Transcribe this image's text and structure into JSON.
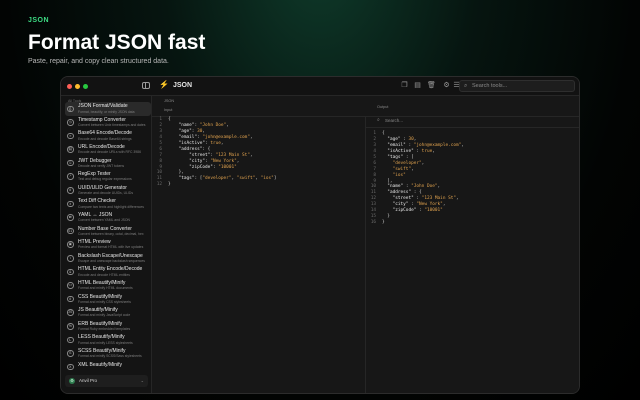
{
  "hero": {
    "tag": "JSON",
    "title": "Format JSON fast",
    "subtitle": "Paste, repair, and copy clean structured data."
  },
  "window": {
    "title": "JSON",
    "search_placeholder": "Search tools..."
  },
  "sidebar": {
    "heading": "All Tools",
    "items": [
      {
        "title": "JSON Format/Validate",
        "desc": "Format, beautify, or minify JSON data",
        "icon": "{}",
        "active": true
      },
      {
        "title": "Timestamp Converter",
        "desc": "Convert between Unix timestamps and dates",
        "icon": "◷",
        "active": false
      },
      {
        "title": "Base64 Encode/Decode",
        "desc": "Encode and decode Base64 strings",
        "icon": "≡",
        "active": false
      },
      {
        "title": "URL Encode/Decode",
        "desc": "Encode and decode URLs with RFC 3986",
        "icon": "⛓",
        "active": false
      },
      {
        "title": "JWT Debugger",
        "desc": "Decode and verify JWT tokens",
        "icon": "⚿",
        "active": false
      },
      {
        "title": "RegExp Tester",
        "desc": "Test and debug regular expressions",
        "icon": ".*",
        "active": false
      },
      {
        "title": "UUID/ULID Generator",
        "desc": "Generate and decode UUIDs, ULIDs",
        "icon": "#",
        "active": false
      },
      {
        "title": "Text Diff Checker",
        "desc": "Compare two texts and highlight differences",
        "icon": "±",
        "active": false
      },
      {
        "title": "YAML ↔ JSON",
        "desc": "Convert between YAML and JSON",
        "icon": "⇄",
        "active": false
      },
      {
        "title": "Number Base Converter",
        "desc": "Convert between binary, octal, decimal, hex",
        "icon": "01",
        "active": false
      },
      {
        "title": "HTML Preview",
        "desc": "Preview and format HTML with live updates",
        "icon": "▣",
        "active": false
      },
      {
        "title": "Backslash Escape/Unescape",
        "desc": "Escape and unescape backslash sequences",
        "icon": "\\",
        "active": false
      },
      {
        "title": "HTML Entity Encode/Decode",
        "desc": "Encode and decode HTML entities",
        "icon": "&",
        "active": false
      },
      {
        "title": "HTML Beautify/Minify",
        "desc": "Format and minify HTML documents",
        "icon": "<>",
        "active": false
      },
      {
        "title": "CSS Beautify/Minify",
        "desc": "Format and minify CSS stylesheets",
        "icon": "#",
        "active": false
      },
      {
        "title": "JS Beautify/Minify",
        "desc": "Format and minify JavaScript code",
        "icon": "JS",
        "active": false
      },
      {
        "title": "ERB Beautify/Minify",
        "desc": "Format Ruby embedded templates",
        "icon": "%",
        "active": false
      },
      {
        "title": "LESS Beautify/Minify",
        "desc": "Format and minify LESS stylesheets",
        "icon": "L",
        "active": false
      },
      {
        "title": "SCSS Beautify/Minify",
        "desc": "Format and minify SCSS/Sass stylesheets",
        "icon": "S",
        "active": false
      },
      {
        "title": "XML Beautify/Minify",
        "desc": "",
        "icon": "X",
        "active": false
      }
    ],
    "footer": {
      "label": "Anvil Pro",
      "icon": "⚙"
    }
  },
  "main": {
    "header_label": "JSON",
    "input_label": "Input",
    "output_label": "Output",
    "output_search_placeholder": "Search..."
  },
  "input_lines": [
    [
      [
        "p",
        "{"
      ]
    ],
    [
      [
        "p",
        "    "
      ],
      [
        "k",
        "\"name\""
      ],
      [
        "p",
        ": "
      ],
      [
        "s",
        "\"John Doe\""
      ],
      [
        "p",
        ","
      ]
    ],
    [
      [
        "p",
        "    "
      ],
      [
        "k",
        "\"age\""
      ],
      [
        "p",
        ": "
      ],
      [
        "n",
        "30"
      ],
      [
        "p",
        ","
      ]
    ],
    [
      [
        "p",
        "    "
      ],
      [
        "k",
        "\"email\""
      ],
      [
        "p",
        ": "
      ],
      [
        "s",
        "\"john@example.com\""
      ],
      [
        "p",
        ","
      ]
    ],
    [
      [
        "p",
        "    "
      ],
      [
        "k",
        "\"isActive\""
      ],
      [
        "p",
        ": "
      ],
      [
        "b",
        "true"
      ],
      [
        "p",
        ","
      ]
    ],
    [
      [
        "p",
        "    "
      ],
      [
        "k",
        "\"address\""
      ],
      [
        "p",
        ": {"
      ]
    ],
    [
      [
        "p",
        "        "
      ],
      [
        "k",
        "\"street\""
      ],
      [
        "p",
        ": "
      ],
      [
        "s",
        "\"123 Main St\""
      ],
      [
        "p",
        ","
      ]
    ],
    [
      [
        "p",
        "        "
      ],
      [
        "k",
        "\"city\""
      ],
      [
        "p",
        ": "
      ],
      [
        "s",
        "\"New York\""
      ],
      [
        "p",
        ","
      ]
    ],
    [
      [
        "p",
        "        "
      ],
      [
        "k",
        "\"zipCode\""
      ],
      [
        "p",
        ": "
      ],
      [
        "s",
        "\"10001\""
      ]
    ],
    [
      [
        "p",
        "    },"
      ]
    ],
    [
      [
        "p",
        "    "
      ],
      [
        "k",
        "\"tags\""
      ],
      [
        "p",
        ": ["
      ],
      [
        "s",
        "\"developer\""
      ],
      [
        "p",
        ", "
      ],
      [
        "s",
        "\"swift\""
      ],
      [
        "p",
        ", "
      ],
      [
        "s",
        "\"ios\""
      ],
      [
        "p",
        "]"
      ]
    ],
    [
      [
        "p",
        "}"
      ]
    ]
  ],
  "output_lines": [
    [
      [
        "p",
        "{"
      ]
    ],
    [
      [
        "p",
        "  "
      ],
      [
        "k",
        "\"age\""
      ],
      [
        "p",
        " : "
      ],
      [
        "n",
        "30"
      ],
      [
        "p",
        ","
      ]
    ],
    [
      [
        "p",
        "  "
      ],
      [
        "k",
        "\"email\""
      ],
      [
        "p",
        " : "
      ],
      [
        "s",
        "\"john@example.com\""
      ],
      [
        "p",
        ","
      ]
    ],
    [
      [
        "p",
        "  "
      ],
      [
        "k",
        "\"isActive\""
      ],
      [
        "p",
        " : "
      ],
      [
        "b",
        "true"
      ],
      [
        "p",
        ","
      ]
    ],
    [
      [
        "p",
        "  "
      ],
      [
        "k",
        "\"tags\""
      ],
      [
        "p",
        " : ["
      ]
    ],
    [
      [
        "p",
        "    "
      ],
      [
        "s",
        "\"developer\""
      ],
      [
        "p",
        ","
      ]
    ],
    [
      [
        "p",
        "    "
      ],
      [
        "s",
        "\"swift\""
      ],
      [
        "p",
        ","
      ]
    ],
    [
      [
        "p",
        "    "
      ],
      [
        "s",
        "\"ios\""
      ]
    ],
    [
      [
        "p",
        "  ],"
      ]
    ],
    [
      [
        "p",
        "  "
      ],
      [
        "k",
        "\"name\""
      ],
      [
        "p",
        " : "
      ],
      [
        "s",
        "\"John Doe\""
      ],
      [
        "p",
        ","
      ]
    ],
    [
      [
        "p",
        "  "
      ],
      [
        "k",
        "\"address\""
      ],
      [
        "p",
        " : {"
      ]
    ],
    [
      [
        "p",
        "    "
      ],
      [
        "k",
        "\"street\""
      ],
      [
        "p",
        " : "
      ],
      [
        "s",
        "\"123 Main St\""
      ],
      [
        "p",
        ","
      ]
    ],
    [
      [
        "p",
        "    "
      ],
      [
        "k",
        "\"city\""
      ],
      [
        "p",
        " : "
      ],
      [
        "s",
        "\"New York\""
      ],
      [
        "p",
        ","
      ]
    ],
    [
      [
        "p",
        "    "
      ],
      [
        "k",
        "\"zipCode\""
      ],
      [
        "p",
        " : "
      ],
      [
        "s",
        "\"10001\""
      ]
    ],
    [
      [
        "p",
        "  }"
      ]
    ],
    [
      [
        "p",
        "}"
      ]
    ]
  ]
}
